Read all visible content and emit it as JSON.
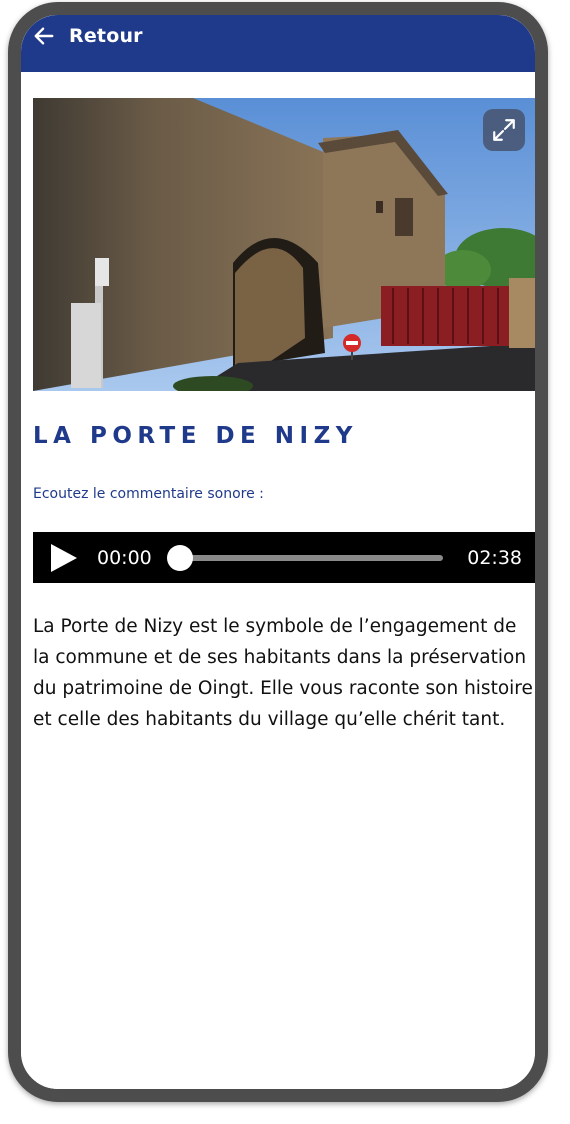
{
  "header": {
    "back_label": "Retour",
    "background_color": "#1f3a8a",
    "back_icon": "arrow-left-icon"
  },
  "hero": {
    "alt": "La Porte de Nizy, stone archway gate in Oingt",
    "expand_icon": "expand-icon"
  },
  "page": {
    "title": "LA PORTE DE NIZY",
    "audio_label": "Ecoutez le commentaire sonore :",
    "description": "La Porte de Nizy est le symbole de l’engagement de la commune et de ses habitants dans la préservation du patrimoine de Oingt. Elle vous raconte son histoire et celle des habitants du village qu’elle chérit tant.",
    "accent_color": "#1f3a8a"
  },
  "audio": {
    "current_time": "00:00",
    "total_time": "02:38",
    "progress": 0,
    "play_icon": "play-icon"
  }
}
